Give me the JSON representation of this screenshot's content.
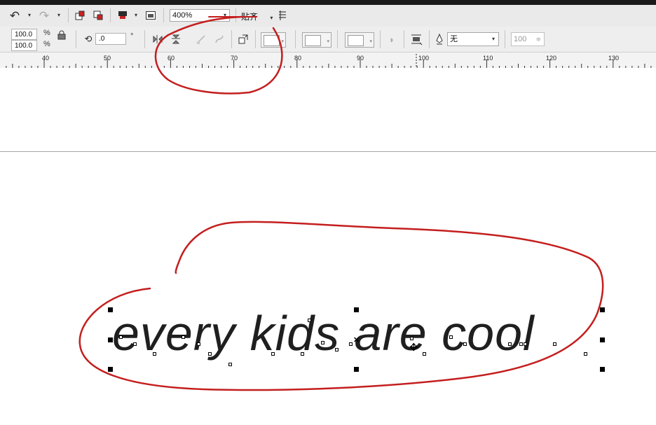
{
  "toolbar_top": {
    "icons": [
      "undo-icon",
      "redo-icon",
      "import-icon",
      "export-icon",
      "publish-pdf-icon",
      "app-launcher-icon",
      "snap-options-icon"
    ],
    "zoom_value": "400%",
    "snap_label": "贴齐",
    "snap_arrow": "▾"
  },
  "property_bar": {
    "scale_width": "100.0",
    "scale_height": "100.0",
    "percent_symbol": "%",
    "rotation_value": ".0",
    "degree_symbol": "°",
    "outline_width": "无",
    "opacity_value": "100"
  },
  "ruler": {
    "labels": [
      "40",
      "50",
      "60",
      "70",
      "80",
      "90",
      "100",
      "110",
      "120",
      "130"
    ]
  },
  "canvas": {
    "text_object": "every kids are cool"
  },
  "annotation": {
    "color": "#c41e1e"
  }
}
